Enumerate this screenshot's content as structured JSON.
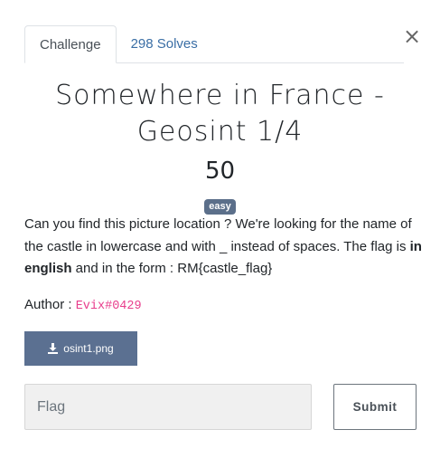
{
  "modal": {
    "close_glyph": "×"
  },
  "tabs": [
    {
      "label": "Challenge",
      "active": true
    },
    {
      "label": "298 Solves",
      "active": false
    }
  ],
  "challenge": {
    "title": "Somewhere in France - Geosint 1/4",
    "value": "50",
    "difficulty": "easy",
    "description": {
      "part1": "Can you find this picture location ? We're looking for the name of the castle in lowercase and with _ instead of spaces. The flag is ",
      "bold": "in english",
      "part2": " and in the form : RM{castle_flag}"
    },
    "author_label": "Author : ",
    "author_handle": "Evix#0429",
    "file": {
      "name": "osint1.png",
      "icon": "download-icon"
    }
  },
  "submission": {
    "flag_placeholder": "Flag",
    "submit_label": "Submit"
  },
  "colors": {
    "link": "#3a6ea5",
    "badge": "#5b6f8a",
    "file_button": "#5b7091",
    "author_handle": "#e83e8c"
  }
}
